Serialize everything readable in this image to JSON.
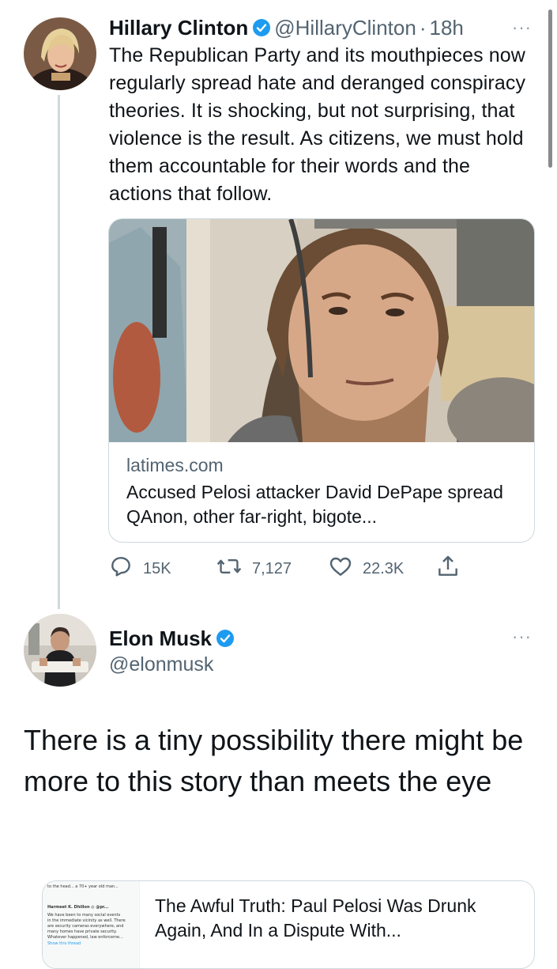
{
  "tweet1": {
    "name": "Hillary Clinton",
    "handle": "@HillaryClinton",
    "dot": "·",
    "time": "18h",
    "more": "···",
    "text": "The Republican Party and its mouthpieces now regularly spread hate and deranged conspiracy theories. It is shocking, but not surprising, that violence is the result. As citizens, we must hold them accountable for their words and the actions that follow.",
    "card": {
      "domain": "latimes.com",
      "title": "Accused Pelosi attacker David DePape spread QAnon, other far-right, bigote..."
    },
    "actions": {
      "replies": "15K",
      "retweets": "7,127",
      "likes": "22.3K"
    }
  },
  "tweet2": {
    "name": "Elon Musk",
    "handle": "@elonmusk",
    "more": "···",
    "text": "There is a tiny possibility there might be more to this story than meets the eye",
    "card": {
      "title": "The Awful Truth: Paul Pelosi Was Drunk Again, And In a Dispute With...",
      "thumb_lines": [
        "to the head... a 70+ year old man...",
        "Harmeet K. Dhillon ◎ @pr...",
        "We have been to many social events",
        "in the immediate vicinity as well. There",
        "are security cameras everywhere, and",
        "many homes have private security.",
        "Whatever happened, law enforceme...",
        "Show this thread"
      ]
    }
  },
  "colors": {
    "text": "#0f1419",
    "muted": "#536471",
    "verified": "#1d9bf0",
    "border": "#cfd9de"
  },
  "icons": [
    "verified-badge-icon",
    "more-icon",
    "reply-icon",
    "retweet-icon",
    "like-icon",
    "share-icon"
  ]
}
